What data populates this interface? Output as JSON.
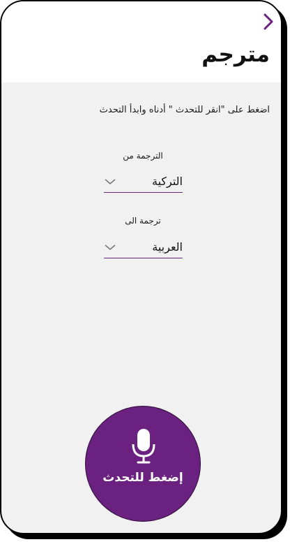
{
  "header": {
    "title": "مترجم",
    "back_icon": "chevron-right-icon"
  },
  "instructions": "اضغط على \"انقر للتحدث \" أدناه وابدأ التحدث",
  "from": {
    "label": "الترجمة من",
    "value": "التركية",
    "icon": "chevron-down-icon"
  },
  "to": {
    "label": "ترجمة الى",
    "value": "العربية",
    "icon": "chevron-down-icon"
  },
  "talk_button": {
    "label": "إضغط للتحدث",
    "icon": "microphone-icon"
  },
  "colors": {
    "accent": "#6b2180",
    "background": "#f1f1f1",
    "header": "#ffffff"
  }
}
